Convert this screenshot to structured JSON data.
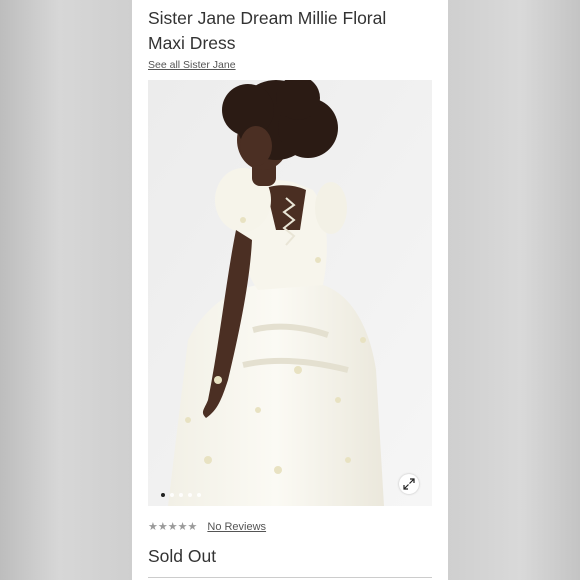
{
  "product": {
    "title": "Sister Jane Dream Millie Floral Maxi Dress",
    "brand_link": "See all Sister Jane",
    "reviews_link": "No Reviews",
    "rating_stars": 0,
    "rating_max": 5,
    "status": "Sold Out"
  },
  "gallery": {
    "image_count": 5,
    "active_index": 0,
    "expand_icon": "expand-icon"
  },
  "colors": {
    "text": "#333333",
    "star_empty": "#9a9a9a",
    "background": "#ffffff"
  }
}
